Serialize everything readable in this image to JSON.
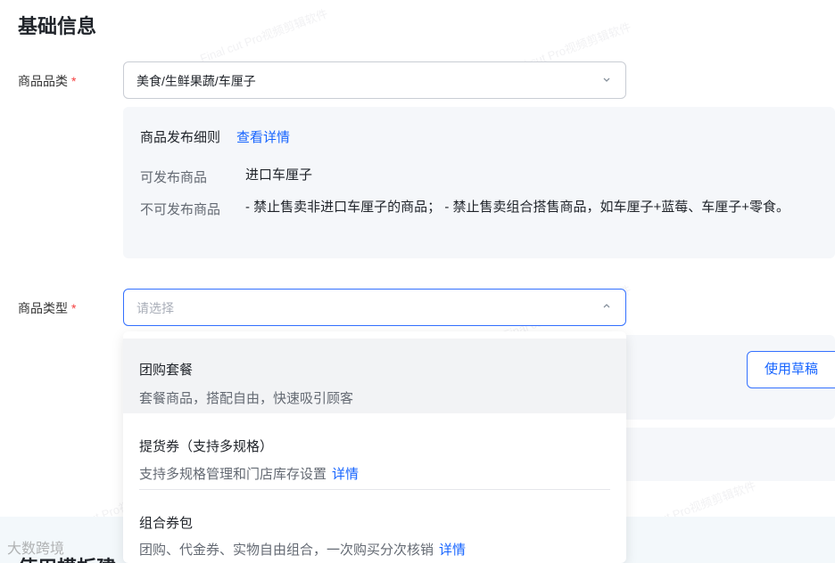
{
  "section": {
    "title": "基础信息"
  },
  "category_field": {
    "label": "商品品类",
    "required_mark": "*",
    "value": "美食/生鲜果蔬/车厘子"
  },
  "rules": {
    "heading": "商品发布细则",
    "link": "查看详情",
    "allowed_label": "可发布商品",
    "allowed_value": "进口车厘子",
    "forbidden_label": "不可发布商品",
    "forbidden_value": "- 禁止售卖非进口车厘子的商品； - 禁止售卖组合搭售商品，如车厘子+蓝莓、车厘子+零食。"
  },
  "type_field": {
    "label": "商品类型",
    "required_mark": "*",
    "placeholder": "请选择"
  },
  "dropdown": {
    "options": [
      {
        "title": "团购套餐",
        "desc": "套餐商品，搭配自由，快速吸引顾客",
        "link": ""
      },
      {
        "title": "提货券（支持多规格）",
        "desc": "支持多规格管理和门店库存设置",
        "link": "详情"
      },
      {
        "title": "组合券包",
        "desc": "团购、代金券、实物自由组合，一次购买分次核销",
        "link": "详情"
      }
    ]
  },
  "draft_button": {
    "label": "使用草稿"
  },
  "bottom": {
    "heading": "使用模板建",
    "logo_text": "大数跨境"
  },
  "colors": {
    "accent": "#1664ff",
    "required": "#f53f3f",
    "panel_bg": "#f5f7fa"
  }
}
